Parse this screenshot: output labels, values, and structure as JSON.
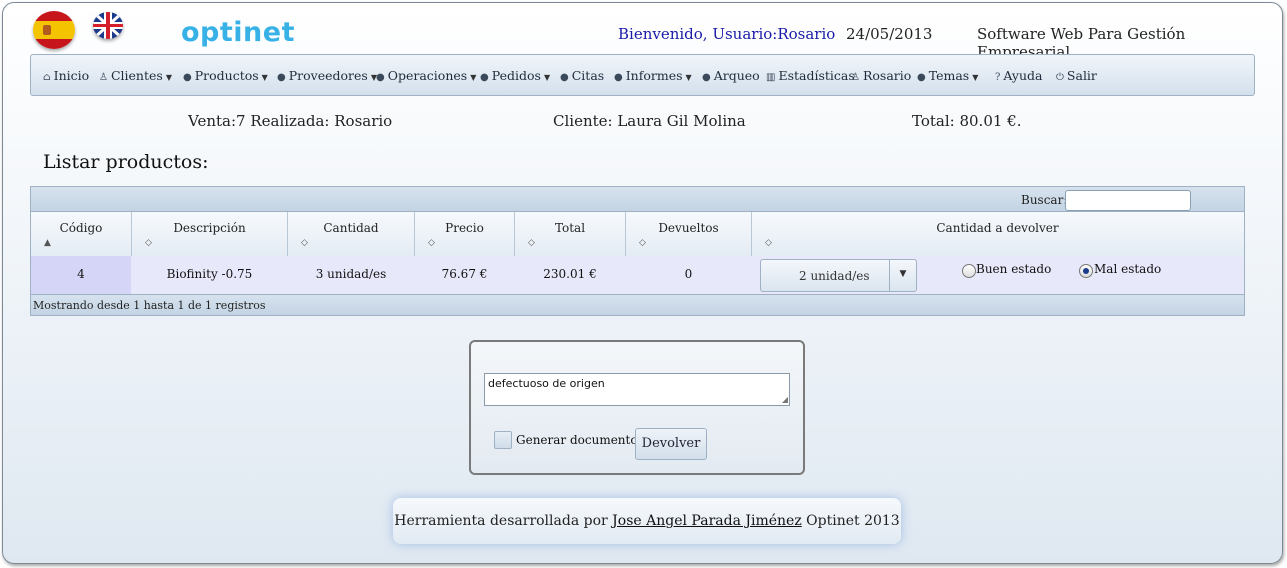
{
  "header": {
    "logo": "optinet",
    "welcome": "Bienvenido, Usuario:Rosario",
    "date": "24/05/2013",
    "tagline": "Software Web Para Gestión Empresarial."
  },
  "nav": {
    "items": [
      {
        "label": "Inicio",
        "icon": "home-icon",
        "has_caret": false
      },
      {
        "label": "Clientes",
        "icon": "user-icon",
        "has_caret": true
      },
      {
        "label": "Productos",
        "icon": "bullet-icon",
        "has_caret": true
      },
      {
        "label": "Proveedores",
        "icon": "bullet-icon",
        "has_caret": true
      },
      {
        "label": "Operaciones",
        "icon": "bullet-icon",
        "has_caret": true
      },
      {
        "label": "Pedidos",
        "icon": "bullet-icon",
        "has_caret": true
      },
      {
        "label": "Citas",
        "icon": "bullet-icon",
        "has_caret": false
      },
      {
        "label": "Informes",
        "icon": "bullet-icon",
        "has_caret": true
      },
      {
        "label": "Arqueo",
        "icon": "bullet-icon",
        "has_caret": false
      },
      {
        "label": "Estadísticas",
        "icon": "chart-icon",
        "has_caret": false
      },
      {
        "label": "Rosario",
        "icon": "user-icon",
        "has_caret": false
      },
      {
        "label": "Temas",
        "icon": "bullet-icon",
        "has_caret": true
      },
      {
        "label": "Ayuda",
        "icon": "help-icon",
        "has_caret": false
      },
      {
        "label": "Salir",
        "icon": "power-icon",
        "has_caret": false
      }
    ]
  },
  "sale": {
    "venta": "Venta:7 Realizada: Rosario",
    "cliente": "Cliente: Laura Gil Molina",
    "total": "Total: 80.01 €."
  },
  "list_title": "Listar productos:",
  "table": {
    "search_label": "Buscar:",
    "search_value": "",
    "columns": [
      "Código",
      "Descripción",
      "Cantidad",
      "Precio",
      "Total",
      "Devueltos",
      "Cantidad a devolver"
    ],
    "rows": [
      {
        "codigo": "4",
        "descripcion": "Biofinity -0.75",
        "cantidad": "3 unidad/es",
        "precio": "76.67 €",
        "total": "230.01 €",
        "devueltos": "0",
        "devolver_qty": "2 unidad/es",
        "estado_options": [
          "Buen estado",
          "Mal estado"
        ],
        "estado_selected": "Mal estado"
      }
    ],
    "footer": "Mostrando desde 1 hasta 1 de 1 registros"
  },
  "return_form": {
    "reason": "defectuoso de origen",
    "generate_doc_label": "Generar documento",
    "generate_doc_checked": false,
    "submit_label": "Devolver"
  },
  "footer": {
    "prefix": "Herramienta desarrollada por",
    "author": "Jose Angel Parada Jiménez",
    "suffix": "Optinet 2013"
  }
}
